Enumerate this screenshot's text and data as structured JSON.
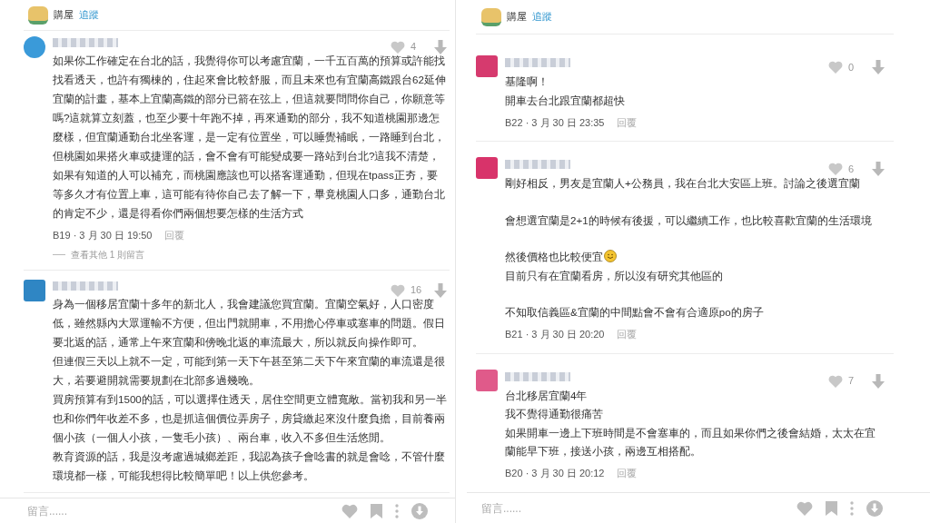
{
  "panels": [
    {
      "board": {
        "name": "購屋",
        "follow": "追蹤"
      },
      "comments": [
        {
          "color": "#3a9ad9",
          "likes": "4",
          "body": [
            {
              "text": "如果你工作確定在台北的話，我覺得你可以考慮宜蘭，一千五百萬的預算或許能找找看透天，也許有獨棟的，住起來會比較舒服，而且未來也有宜蘭高鐵跟台62延伸宜蘭的計畫，基本上宜蘭高鐵的部分已箭在弦上，但這就要問問你自己，你願意等嗎?這就算立刻蓋，也至少要十年跑不掉，再來通勤的部分，我不知道桃園那邊怎麼樣，但宜蘭通勤台北坐客運，是一定有位置坐，可以睡覺補眠，一路睡到台北，但桃園如果搭火車或捷運的話，會不會有可能變成要一路站到台北?這我不清楚，如果有知道的人可以補充，而桃園應該也可以搭客運通勤，但現在tpass正夯，要等多久才有位置上車，這可能有待你自己去了解一下，畢竟桃園人口多，通勤台北的肯定不少，還是得看你們兩個想要怎樣的生活方式",
              "spaced": false,
              "emoji": false
            }
          ],
          "meta": "B19 · 3 月 30 日 19:50",
          "reply": "回覆",
          "more_replies": "查看其他 1 則留言"
        },
        {
          "color": "#2f86c4",
          "likes": "16",
          "body": [
            {
              "text": "身為一個移居宜蘭十多年的新北人，我會建議您買宜蘭。宜蘭空氣好，人口密度低，雖然縣內大眾運輸不方便，但出門就開車，不用擔心停車或塞車的問題。假日要北返的話，通常上午來宜蘭和傍晚北返的車流最大，所以就反向操作即可。",
              "spaced": false,
              "emoji": false
            },
            {
              "text": "但連假三天以上就不一定，可能到第一天下午甚至第二天下午來宜蘭的車流還是很大，若要避開就需要規劃在北部多過幾晚。",
              "spaced": false,
              "emoji": false
            },
            {
              "text": "買房預算有到1500的話，可以選擇住透天，居住空間更立體寬敞。當初我和另一半也和你們年收差不多，也是抓這個價位弄房子，房貸繳起來沒什麼負擔，目前養兩個小孩（一個人小孩，一隻毛小孩）、兩台車，收入不多但生活悠閒。",
              "spaced": false,
              "emoji": false
            },
            {
              "text": "教育資源的話，我是沒考慮過城鄉差距，我認為孩子會唸書的就是會唸，不管什麼環境都一樣，可能我想得比較簡單吧！以上供您參考。",
              "spaced": false,
              "emoji": false
            }
          ]
        }
      ],
      "comment_box": {
        "placeholder": "留言......"
      }
    },
    {
      "board": {
        "name": "購屋",
        "follow": "追蹤"
      },
      "comments": [
        {
          "color": "#d63a6e",
          "likes": "0",
          "body": [
            {
              "text": "基隆啊！",
              "spaced": false,
              "emoji": false
            },
            {
              "text": "開車去台北跟宜蘭都超快",
              "spaced": false,
              "emoji": false
            }
          ],
          "meta": "B22 · 3 月 30 日 23:35",
          "reply": "回覆"
        },
        {
          "color": "#d8336a",
          "likes": "6",
          "body": [
            {
              "text": "剛好相反，男友是宜蘭人+公務員，我在台北大安區上班。討論之後選宜蘭",
              "spaced": false,
              "emoji": false
            },
            {
              "text": "會想選宜蘭是2+1的時候有後援，可以繼續工作，也比較喜歡宜蘭的生活環境",
              "spaced": true,
              "emoji": false
            },
            {
              "text": "然後價格也比較便宜",
              "spaced": true,
              "emoji": true
            },
            {
              "text": "目前只有在宜蘭看房，所以沒有研究其他區的",
              "spaced": false,
              "emoji": false
            },
            {
              "text": "不知取信義區&宜蘭的中間點會不會有合適原po的房子",
              "spaced": true,
              "emoji": false
            }
          ],
          "meta": "B21 · 3 月 30 日 20:20",
          "reply": "回覆"
        },
        {
          "color": "#e05a8a",
          "likes": "7",
          "body": [
            {
              "text": "台北移居宜蘭4年",
              "spaced": false,
              "emoji": false
            },
            {
              "text": "我不覺得通勤很痛苦",
              "spaced": false,
              "emoji": false
            },
            {
              "text": "如果開車一邊上下班時間是不會塞車的，而且如果你們之後會結婚，太太在宜蘭能早下班，接送小孩，兩邊互相搭配。",
              "spaced": false,
              "emoji": false
            }
          ],
          "meta": "B20 · 3 月 30 日 20:12",
          "reply": "回覆"
        }
      ],
      "comment_box": {
        "placeholder": "留言......"
      }
    }
  ]
}
